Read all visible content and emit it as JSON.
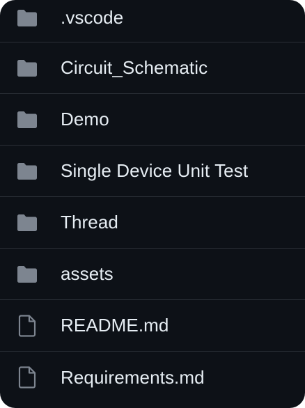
{
  "file_list": {
    "items": [
      {
        "name": ".vscode",
        "type": "folder",
        "icon": "folder-icon"
      },
      {
        "name": "Circuit_Schematic",
        "type": "folder",
        "icon": "folder-icon"
      },
      {
        "name": "Demo",
        "type": "folder",
        "icon": "folder-icon"
      },
      {
        "name": "Single Device Unit Test",
        "type": "folder",
        "icon": "folder-icon"
      },
      {
        "name": "Thread",
        "type": "folder",
        "icon": "folder-icon"
      },
      {
        "name": "assets",
        "type": "folder",
        "icon": "folder-icon"
      },
      {
        "name": "README.md",
        "type": "file",
        "icon": "file-icon"
      },
      {
        "name": "Requirements.md",
        "type": "file",
        "icon": "file-icon"
      }
    ]
  },
  "colors": {
    "background": "#0d1117",
    "divider": "#2b3038",
    "text": "#e6edf3",
    "icon": "#7d8590"
  }
}
